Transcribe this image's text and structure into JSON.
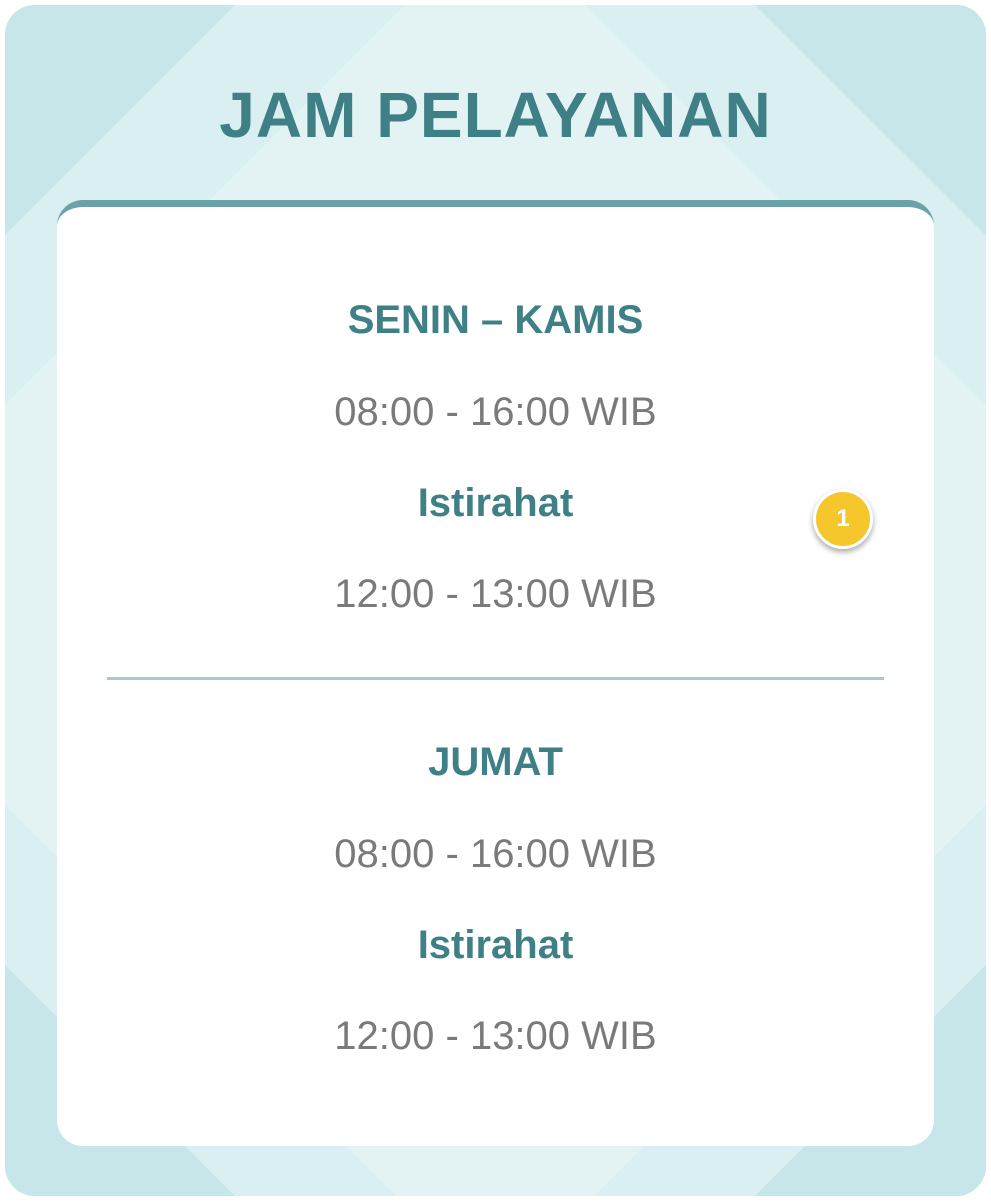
{
  "header": {
    "title": "JAM PELAYANAN"
  },
  "schedule": [
    {
      "days": "SENIN – KAMIS",
      "hours": "08:00 - 16:00 WIB",
      "break_label": "Istirahat",
      "break_hours": "12:00 - 13:00 WIB"
    },
    {
      "days": "JUMAT",
      "hours": "08:00 - 16:00 WIB",
      "break_label": "Istirahat",
      "break_hours": "12:00 - 13:00 WIB"
    }
  ],
  "marker": {
    "label": "1"
  },
  "colors": {
    "accent": "#3f7f86",
    "panel_bg": "#cde9ec",
    "card_border": "#6aa2a8",
    "time_text": "#7a7a7a",
    "badge": "#f6c62d"
  }
}
